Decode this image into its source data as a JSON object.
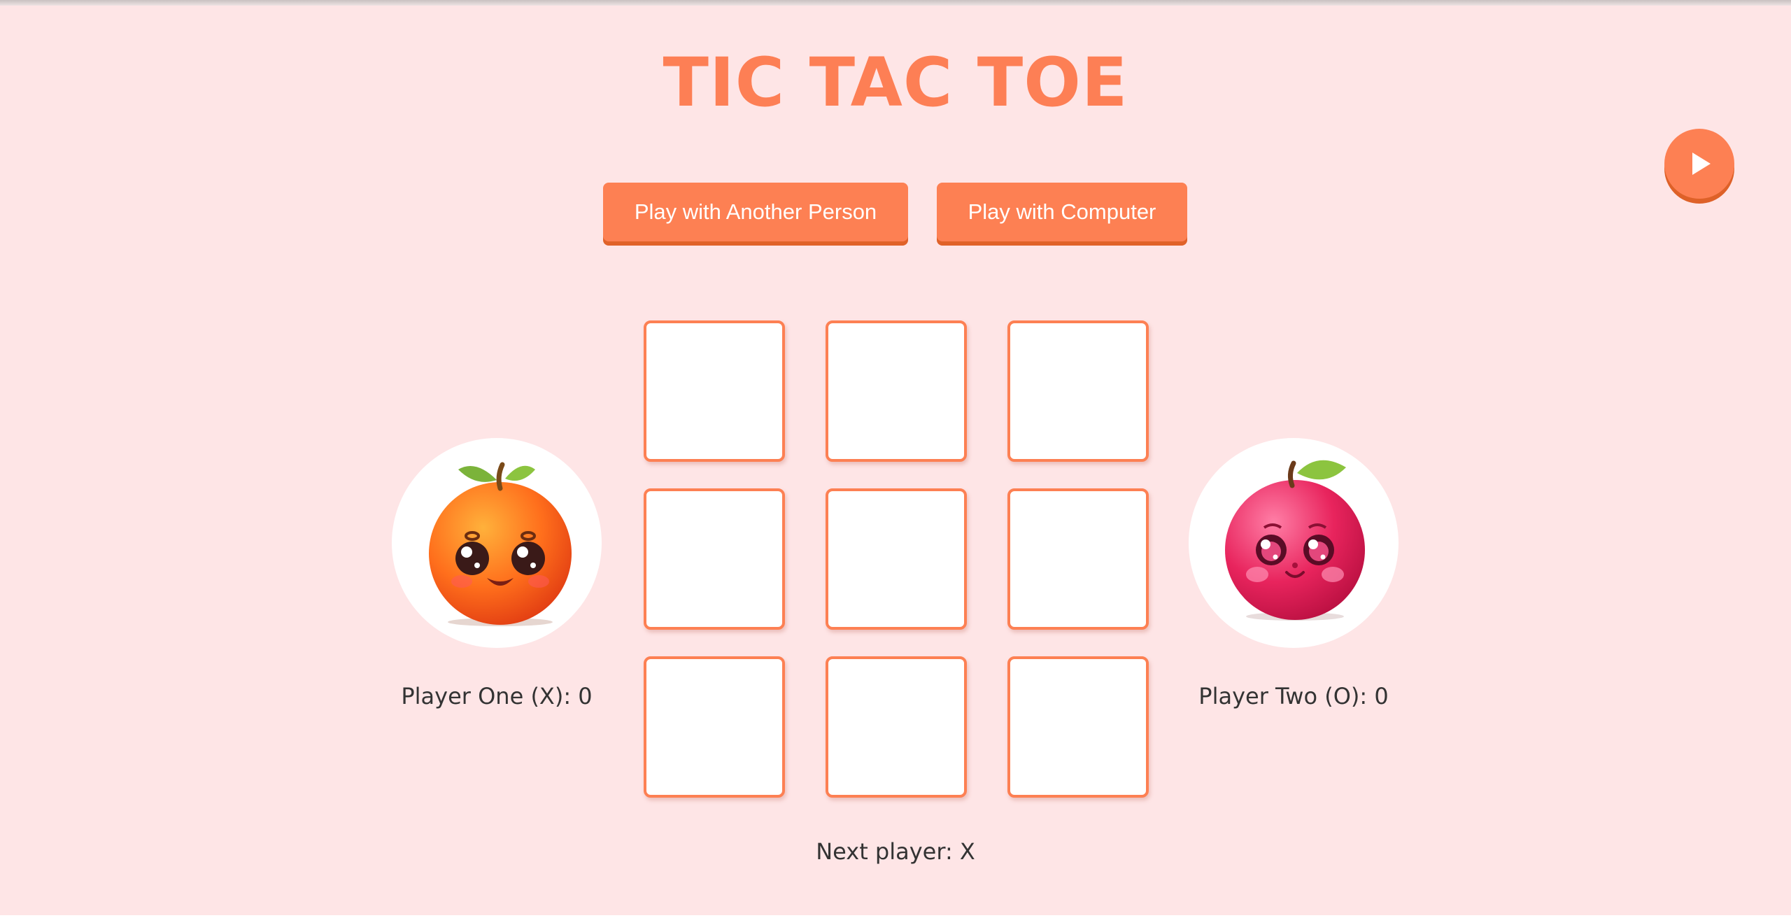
{
  "title": "TIC TAC TOE",
  "modes": {
    "pvp_label": "Play with Another Person",
    "pvc_label": "Play with Computer"
  },
  "controls": {
    "play_icon": "play-icon"
  },
  "board": {
    "cells": [
      "",
      "",
      "",
      "",
      "",
      "",
      "",
      "",
      ""
    ]
  },
  "players": {
    "one": {
      "score_text": "Player One (X): 0",
      "avatar": "orange-character"
    },
    "two": {
      "score_text": "Player Two (O): 0",
      "avatar": "apple-character"
    }
  },
  "status": {
    "next_player": "Next player: X"
  },
  "colors": {
    "background": "#fee5e6",
    "accent": "#fd8053",
    "accent_dark": "#e06229",
    "text": "#333333"
  }
}
